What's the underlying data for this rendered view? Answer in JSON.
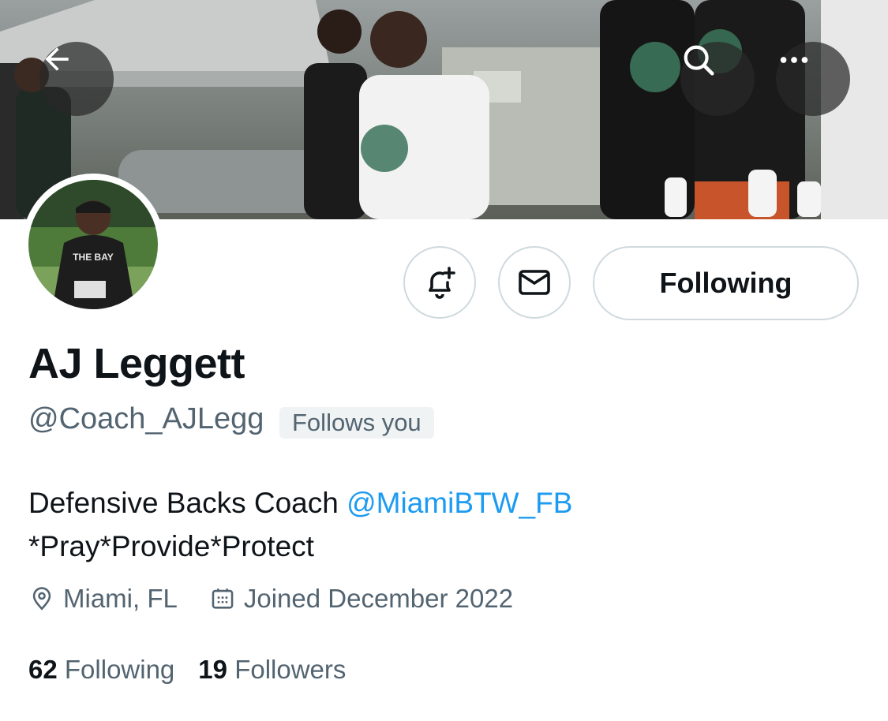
{
  "header": {
    "back_icon": "arrow-left-icon",
    "search_icon": "search-icon",
    "more_icon": "ellipsis-icon"
  },
  "banner": {
    "shirt_text": "THE BAY"
  },
  "actions": {
    "notify_icon": "bell-plus-icon",
    "message_icon": "envelope-icon",
    "following_label": "Following"
  },
  "profile": {
    "display_name": "AJ Leggett",
    "handle": "@Coach_AJLegg",
    "follows_you": "Follows you",
    "bio_line1_text": "Defensive Backs Coach ",
    "bio_mention": "@MiamiBTW_FB",
    "bio_line2": "*Pray*Provide*Protect",
    "location": "Miami, FL",
    "joined": "Joined December 2022",
    "following_count": "62",
    "following_label": "Following",
    "followers_count": "19",
    "followers_label": "Followers"
  },
  "colors": {
    "accent": "#1d9bf0",
    "secondary_text": "#536471",
    "primary_text": "#0f1419",
    "border": "#cfd9de"
  }
}
